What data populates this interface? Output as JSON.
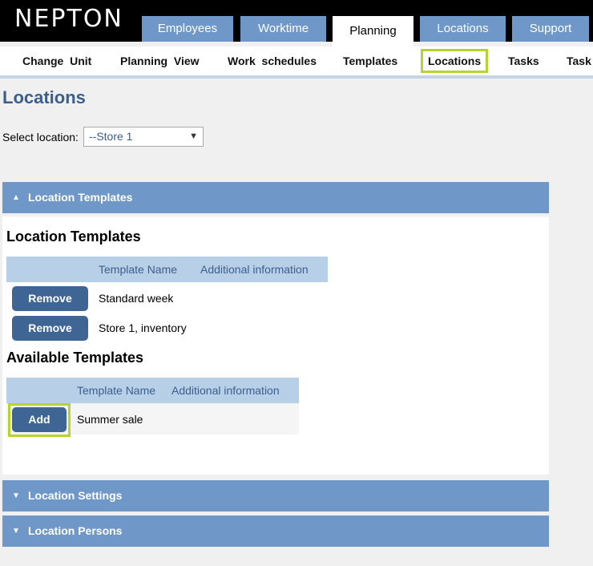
{
  "app": {
    "logo": "NEPTON"
  },
  "main_tabs": [
    {
      "label": "Employees"
    },
    {
      "label": "Worktime"
    },
    {
      "label": "Planning"
    },
    {
      "label": "Locations"
    },
    {
      "label": "Support"
    }
  ],
  "sub_nav": [
    {
      "label": "Change  Unit"
    },
    {
      "label": "Planning  View"
    },
    {
      "label": "Work  schedules"
    },
    {
      "label": "Templates"
    },
    {
      "label": "Locations"
    },
    {
      "label": "Tasks"
    },
    {
      "label": "Task"
    }
  ],
  "page": {
    "title": "Locations"
  },
  "location_select": {
    "label": "Select location:",
    "value": "--Store 1"
  },
  "location_templates_panel": {
    "header": "Location Templates",
    "assigned": {
      "title": "Location Templates",
      "columns": [
        "Template Name",
        "Additional information"
      ],
      "rows": [
        {
          "action": "Remove",
          "name": "Standard week"
        },
        {
          "action": "Remove",
          "name": "Store 1, inventory"
        }
      ]
    },
    "available": {
      "title": "Available Templates",
      "columns": [
        "Template Name",
        "Additional information"
      ],
      "rows": [
        {
          "action": "Add",
          "name": "Summer sale"
        }
      ]
    }
  },
  "location_settings_panel": {
    "header": "Location Settings"
  },
  "location_persons_panel": {
    "header": "Location Persons"
  },
  "colors": {
    "accent": "#6f98c8",
    "button": "#3f6595",
    "highlight": "#b5d333",
    "title": "#3a5f8c"
  }
}
